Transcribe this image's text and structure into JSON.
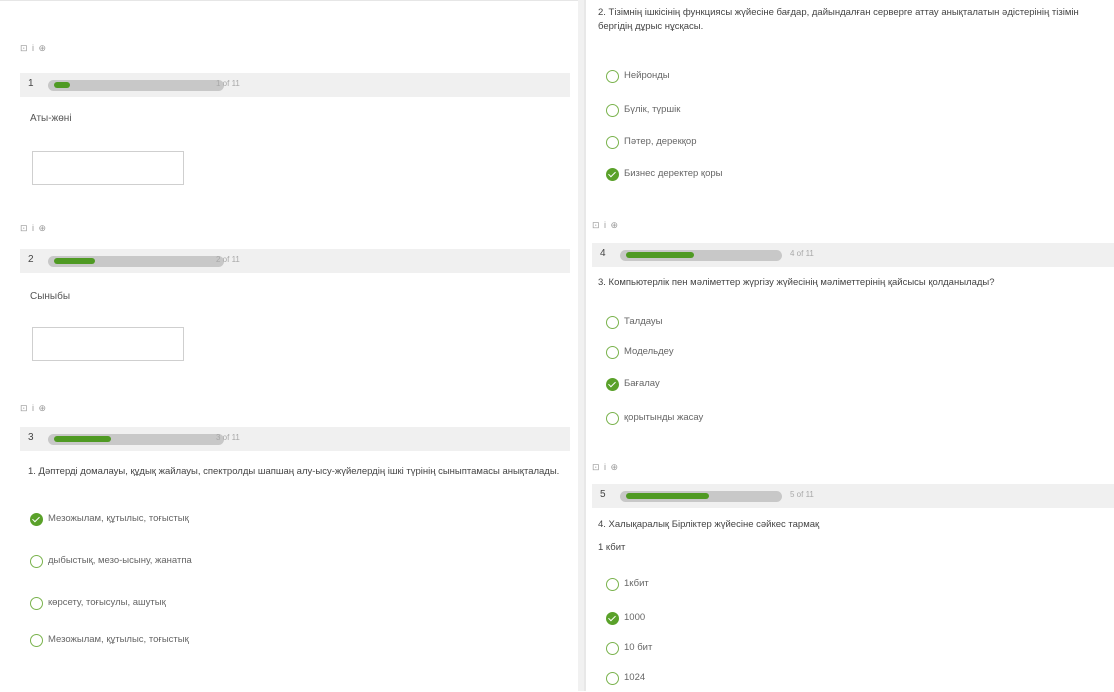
{
  "left": {
    "q1": {
      "meta": "⊡ i  ⊕",
      "number": "1",
      "progress": 0.1,
      "of": "1 of 11",
      "label": "Аты-жөні",
      "input_value": ""
    },
    "q2": {
      "meta": "⊡ i  ⊕",
      "number": "2",
      "progress": 0.25,
      "of": "2 of 11",
      "label": "Сыныбы",
      "input_value": ""
    },
    "q3": {
      "meta": "⊡ i  ⊕",
      "number": "3",
      "progress": 0.35,
      "of": "3 of 11",
      "question": "1. Дәптерді домалауы, құдық жайлауы, спектролды шапшаң алу-ысу-жүйелердің ішкі түрінің сыныптамасы анықталады.",
      "options": [
        {
          "text": "Мезожылам, құтылыс, тоғыстық",
          "checked": true
        },
        {
          "text": "дыбыстық, мезо-ысыну, жанатпа",
          "checked": false
        },
        {
          "text": "көрсету, тоғысулы, ашутық",
          "checked": false
        },
        {
          "text": "Мезожылам, құтылыс, тоғыстық",
          "checked": false
        }
      ]
    }
  },
  "right": {
    "top_question": {
      "question": "2. Тізімнің ішкісінің функциясы жүйесіне бағдар, дайындалған серверге аттау анықталатын әдістерінің тізімін бергідің дұрыс нұсқасы.",
      "options": [
        {
          "text": "Нейронды",
          "checked": false
        },
        {
          "text": "Бүлік, түршік",
          "checked": false
        },
        {
          "text": "Пәтер, дерекқор",
          "checked": false
        },
        {
          "text": "Бизнес деректер қоры",
          "checked": true
        }
      ]
    },
    "q4": {
      "meta": "⊡ i  ⊕",
      "number": "4",
      "progress": 0.45,
      "of": "4 of 11",
      "question": "3. Компьютерлік пен мәліметтер жүргізу жүйесінің мәліметтерінің қайсысы қолданылады?",
      "options": [
        {
          "text": "Талдауы",
          "checked": false
        },
        {
          "text": "Модельдеу",
          "checked": false
        },
        {
          "text": "Бағалау",
          "checked": true
        },
        {
          "text": "қорытынды жасау",
          "checked": false
        }
      ]
    },
    "q5": {
      "meta": "⊡ i  ⊕",
      "number": "5",
      "progress": 0.55,
      "of": "5 of 11",
      "question": "4. Халықаралық Бірліктер жүйесіне сәйкес тармақ",
      "question_line2": "1 кбит",
      "options": [
        {
          "text": "1кбит",
          "checked": false
        },
        {
          "text": "1000",
          "checked": true
        },
        {
          "text": "10 бит",
          "checked": false
        },
        {
          "text": "1024",
          "checked": false
        }
      ]
    }
  }
}
